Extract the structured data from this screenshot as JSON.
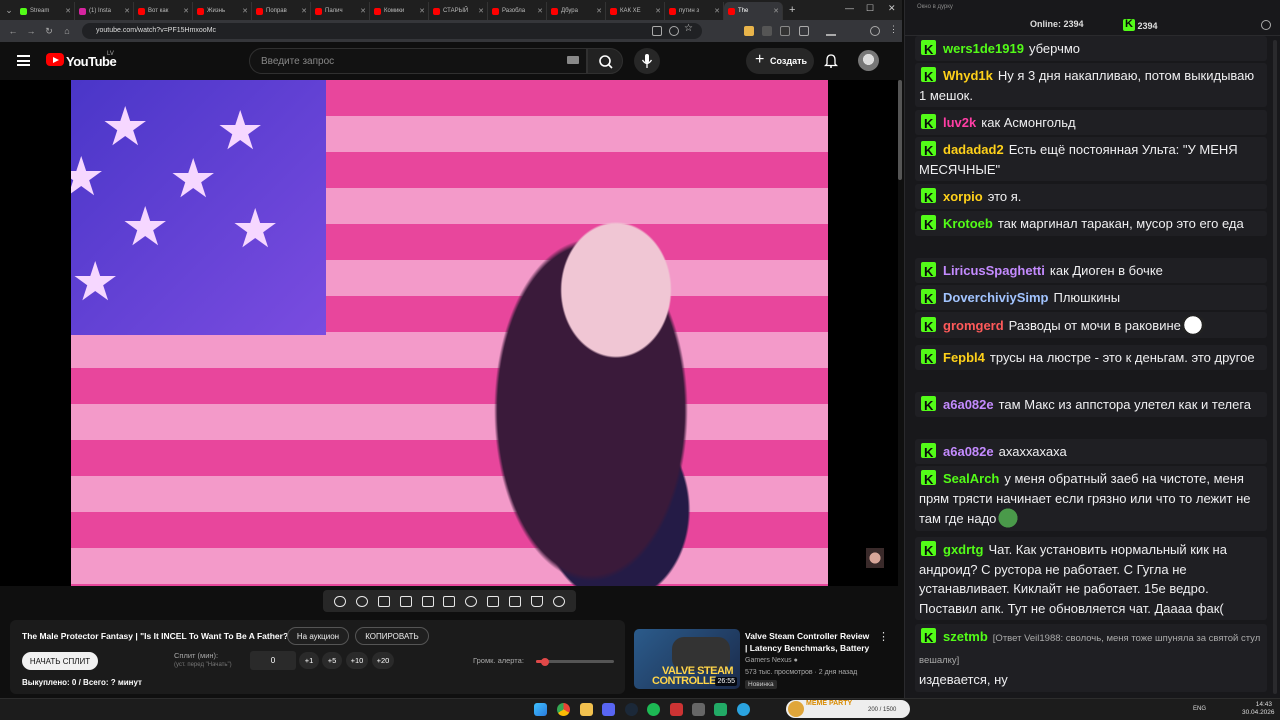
{
  "browser": {
    "tabs": [
      {
        "label": "Stream",
        "color": "#53fc18"
      },
      {
        "label": "(1) Insta",
        "color": "#d6249f"
      },
      {
        "label": "Вот как",
        "color": "#ff0000"
      },
      {
        "label": "Жизнь",
        "color": "#ff0000"
      },
      {
        "label": "Поправ",
        "color": "#ff0000"
      },
      {
        "label": "Палич",
        "color": "#ff0000"
      },
      {
        "label": "Комики",
        "color": "#ff0000"
      },
      {
        "label": "СТАРЫЙ",
        "color": "#ff0000"
      },
      {
        "label": "Разобла",
        "color": "#ff0000"
      },
      {
        "label": "Дбура",
        "color": "#ff0000"
      },
      {
        "label": "КАК ХЕ",
        "color": "#ff0000"
      },
      {
        "label": "путин з",
        "color": "#ff0000"
      },
      {
        "label": "The",
        "color": "#ff0000",
        "active": true
      }
    ],
    "url": "youtube.com/watch?v=PF15HmxooMc"
  },
  "youtube": {
    "region": "LV",
    "logo_text": "YouTube",
    "search_placeholder": "Введите запрос",
    "create_label": "Создать"
  },
  "video": {
    "title": "The Male Protector Fantasy | \"Is It INCEL To Want To Be A Father?\""
  },
  "panel": {
    "auction_label": "На аукцион",
    "copy_label": "КОПИРОВАТЬ",
    "start_split_label": "НАЧАТЬ СПЛИТ",
    "split_label": "Сплит (мин):",
    "split_sub": "(уст. перед \"Начать\")",
    "split_value": "0",
    "increments": [
      "+1",
      "+5",
      "+10",
      "+20"
    ],
    "alert_volume_label": "Громк. алерта:",
    "alert_volume": 0.12,
    "bought": "Выкуплено: 0 / Всего: ? минут"
  },
  "recommendation": {
    "title": "Valve Steam Controller Review | Latency Benchmarks, Battery ...",
    "channel": "Gamers Nexus",
    "meta": "573 тыс. просмотров · 2 дня назад",
    "badge": "Новинка",
    "duration": "26:55",
    "thumb_word1": "VALVE STEAM",
    "thumb_word2": "CONTROLLE"
  },
  "chat": {
    "window_title": "Окно в дурку",
    "online_label": "Online:",
    "online_count": "2394",
    "kick_count": "2394",
    "messages": [
      {
        "user": "wers1de1919",
        "color": "#53fc18",
        "text": "уберчмо"
      },
      {
        "user": "Whyd1k",
        "color": "#ffd11a",
        "text": "Ну я 3 дня накапливаю, потом выкидываю 1 мешок."
      },
      {
        "user": "luv2k",
        "color": "#ff3ea5",
        "text": "как Асмонгольд"
      },
      {
        "user": "dadadad2",
        "color": "#ffd11a",
        "text": "Есть ещё постоянная Ульта: \"У МЕНЯ МЕСЯЧНЫЕ\""
      },
      {
        "user": "xorpio",
        "color": "#ffd11a",
        "text": "это я."
      },
      {
        "user": "Krotoeb",
        "color": "#53fc18",
        "text": "так маргинал таракан, мусор это его еда"
      },
      {
        "user": "LiricusSpaghetti",
        "color": "#c48bff",
        "text": "как Диоген в бочке"
      },
      {
        "user": "DoverchiviySimp",
        "color": "#a2c4ff",
        "text": "Плюшкины"
      },
      {
        "user": "gromgerd",
        "color": "#ff5a5a",
        "text": "Разводы от мочи в раковине",
        "emote": "troll"
      },
      {
        "user": "Fepbl4",
        "color": "#ffd11a",
        "text": "трусы на люстре - это к деньгам. это другое"
      },
      {
        "user": "a6a082e",
        "color": "#c48bff",
        "text": "там Макс из аппстора улетел как и телега"
      },
      {
        "user": "a6a082e",
        "color": "#c48bff",
        "text": "ахаххахаха"
      },
      {
        "user": "SealArch",
        "color": "#53fc18",
        "text": "у меня обратный заеб на чистоте, меня прям трясти начинает если грязно или что то лежит не там где надо",
        "emote": "frog"
      },
      {
        "user": "gxdrtg",
        "color": "#53fc18",
        "text": "Чат. Как установить нормальный кик на андроид? С рустора не работает. С Гугла не устанавливает. Киклайт не работает. 15е ведро. Поставил апк. Тут не обновляется чат. Даааа фак("
      },
      {
        "user": "szetmb",
        "color": "#53fc18",
        "reply": "[Ответ Veil1988: сволочь, меня тоже шпуняла за святой стул вешалку]",
        "text": "издевается, ну"
      }
    ]
  },
  "taskbar": {
    "banner_title": "MEME PARTY",
    "banner_progress": "200 / 1500",
    "lang": "ENG",
    "time": "14:43",
    "date": "30.04.2026"
  }
}
